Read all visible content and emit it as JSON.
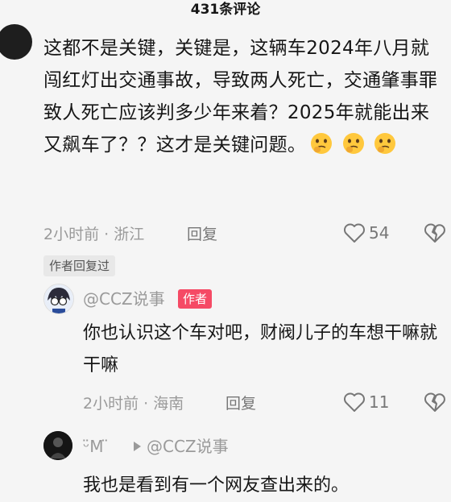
{
  "header": {
    "title": "431条评论"
  },
  "comment": {
    "text": "这都不是关键，关键是，这辆车2024年八月就闯红灯出交通事故，导致两人死亡，交通肇事罪致人死亡应该判多少年来着？2025年就能出来又飙车了？？这才是关键问题。",
    "emojis": [
      "thinking-face-icon",
      "thinking-face-icon",
      "thinking-face-icon"
    ],
    "meta": "2小时前 · 浙江",
    "reply_label": "回复",
    "likes": "54",
    "author_replied_tag": "作者回复过"
  },
  "replies": [
    {
      "name": "@CCZ说事",
      "badge": "作者",
      "text": "你也认识这个车对吧，财阀儿子的车想干嘛就干嘛",
      "meta": "2小时前 · 海南",
      "reply_label": "回复",
      "likes": "11"
    },
    {
      "name": "ᵕ̈M ̈",
      "reply_to": "@CCZ说事",
      "text": "我也是看到有一个网友查出来的。"
    }
  ],
  "colors": {
    "author_badge": "#f54a65",
    "secondary_text": "#9a9a9a"
  }
}
